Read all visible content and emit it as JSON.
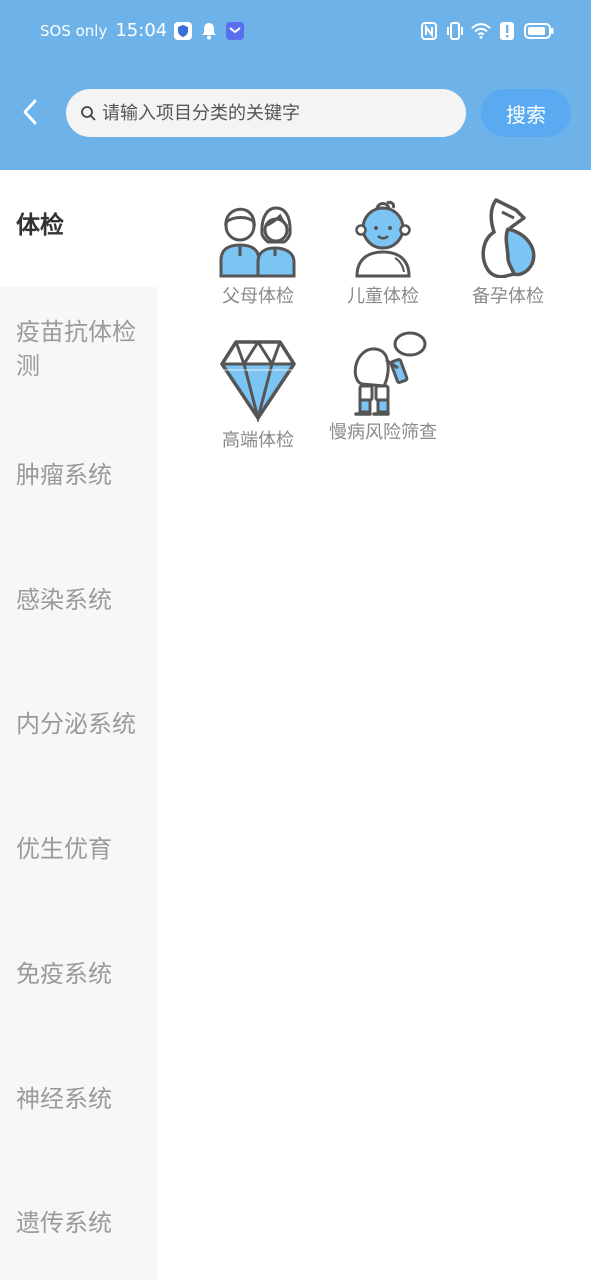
{
  "status_bar": {
    "carrier": "SOS only",
    "time": "15:04"
  },
  "search": {
    "placeholder": "请输入项目分类的关键字",
    "button_label": "搜索"
  },
  "categories": [
    {
      "label": "体检",
      "active": true
    },
    {
      "label": "疫苗抗体检测",
      "active": false
    },
    {
      "label": "肿瘤系统",
      "active": false
    },
    {
      "label": "感染系统",
      "active": false
    },
    {
      "label": "内分泌系统",
      "active": false
    },
    {
      "label": "优生优育",
      "active": false
    },
    {
      "label": "免疫系统",
      "active": false
    },
    {
      "label": "神经系统",
      "active": false
    },
    {
      "label": "遗传系统",
      "active": false
    }
  ],
  "items": [
    {
      "label": "父母体检",
      "icon": "parents-icon"
    },
    {
      "label": "儿童体检",
      "icon": "child-icon"
    },
    {
      "label": "备孕体检",
      "icon": "pregnancy-icon"
    },
    {
      "label": "高端体检",
      "icon": "diamond-icon"
    },
    {
      "label": "慢病风险筛查",
      "icon": "elderly-icon"
    }
  ],
  "colors": {
    "header": "#6db3ea",
    "accent": "#59aaf0",
    "icon_fill": "#7cc4f4",
    "icon_stroke": "#555555"
  }
}
